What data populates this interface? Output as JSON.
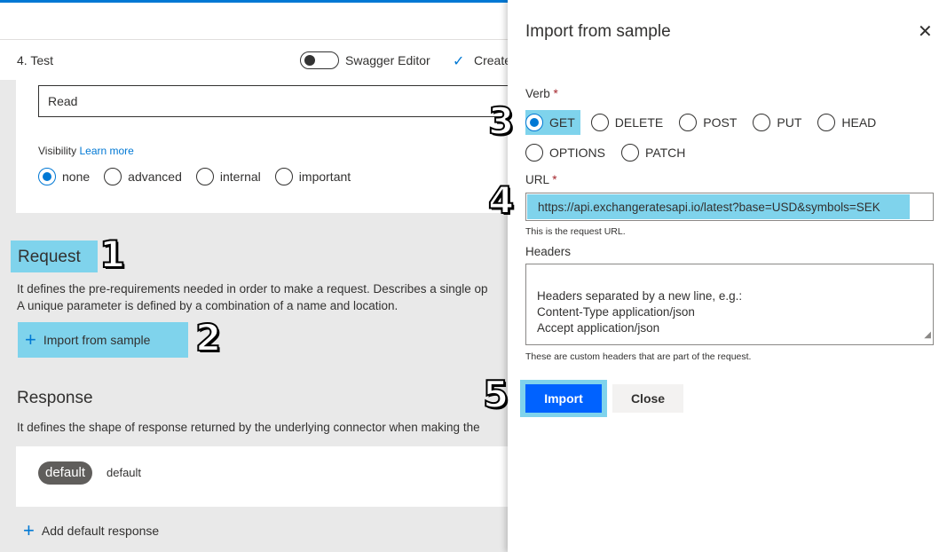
{
  "toolbar": {
    "step_label": "4. Test",
    "swagger_label": "Swagger Editor",
    "create_label": "Create"
  },
  "general": {
    "summary_value": "Read",
    "visibility_label": "Visibility",
    "learn_more": "Learn more",
    "visibility_options": [
      "none",
      "advanced",
      "internal",
      "important"
    ],
    "visibility_selected": "none"
  },
  "request": {
    "title": "Request",
    "description_line1": "It defines the pre-requirements needed in order to make a request. Describes a single op",
    "description_line2": "A unique parameter is defined by a combination of a name and location.",
    "import_label": "Import from sample"
  },
  "response": {
    "title": "Response",
    "description": "It defines the shape of response returned by the underlying connector when making the",
    "badge": "default",
    "badge_text": "default",
    "add_label": "Add default response"
  },
  "markers": [
    "1",
    "2",
    "3",
    "4",
    "5"
  ],
  "panel": {
    "title": "Import from sample",
    "verb_label": "Verb",
    "required_mark": "*",
    "verbs_row1": [
      "GET",
      "DELETE",
      "POST",
      "PUT",
      "HEAD"
    ],
    "verbs_row2": [
      "OPTIONS",
      "PATCH"
    ],
    "verb_selected": "GET",
    "url_label": "URL",
    "url_value": "https://api.exchangeratesapi.io/latest?base=USD&symbols=SEK",
    "url_hint": "This is the request URL.",
    "headers_label": "Headers",
    "headers_placeholder": "Headers separated by a new line, e.g.:\nContent-Type application/json\nAccept application/json",
    "headers_hint": "These are custom headers that are part of the request.",
    "import_button": "Import",
    "close_button": "Close"
  },
  "colors": {
    "accent": "#0078d4",
    "highlight": "#7fd3ec",
    "primary_button": "#0062ff"
  },
  "icons": [
    "check-icon",
    "plus-icon",
    "close-icon",
    "resize-icon"
  ]
}
